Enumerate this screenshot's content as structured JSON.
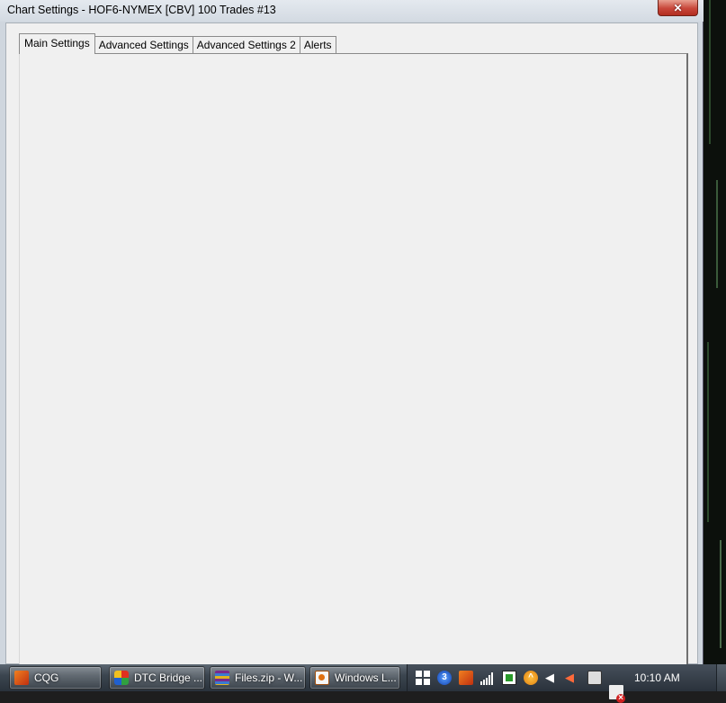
{
  "window": {
    "title": "Chart Settings - HOF6-NYMEX [CBV]  100 Trades  #13",
    "close_label": "✕"
  },
  "tabs": [
    {
      "label": "Main Settings",
      "active": true
    },
    {
      "label": "Advanced Settings",
      "active": false
    },
    {
      "label": "Advanced Settings 2",
      "active": false
    },
    {
      "label": "Alerts",
      "active": false
    }
  ],
  "taskbar": {
    "buttons": [
      {
        "label": "CQG",
        "icon": "cqg-icon"
      },
      {
        "label": "DTC Bridge ...",
        "icon": "dtc-bridge-icon"
      },
      {
        "label": "Files.zip - W...",
        "icon": "winrar-icon"
      },
      {
        "label": "Windows L...",
        "icon": "windows-live-icon"
      }
    ],
    "tray": {
      "badge_number": "3",
      "icons": [
        "windows-flag-icon",
        "number-badge-icon",
        "cqg-tray-icon",
        "signal-bars-icon",
        "network-board-icon",
        "update-arrow-icon",
        "speaker-icon",
        "volume-icon",
        "power-plug-icon",
        "action-center-icon"
      ]
    },
    "clock": "10:10 AM"
  },
  "colors": {
    "window_face": "#f0f0f0",
    "title_gradient_top": "#e4e9ef",
    "close_button": "#c8473a",
    "taskbar": "#3c4650"
  }
}
